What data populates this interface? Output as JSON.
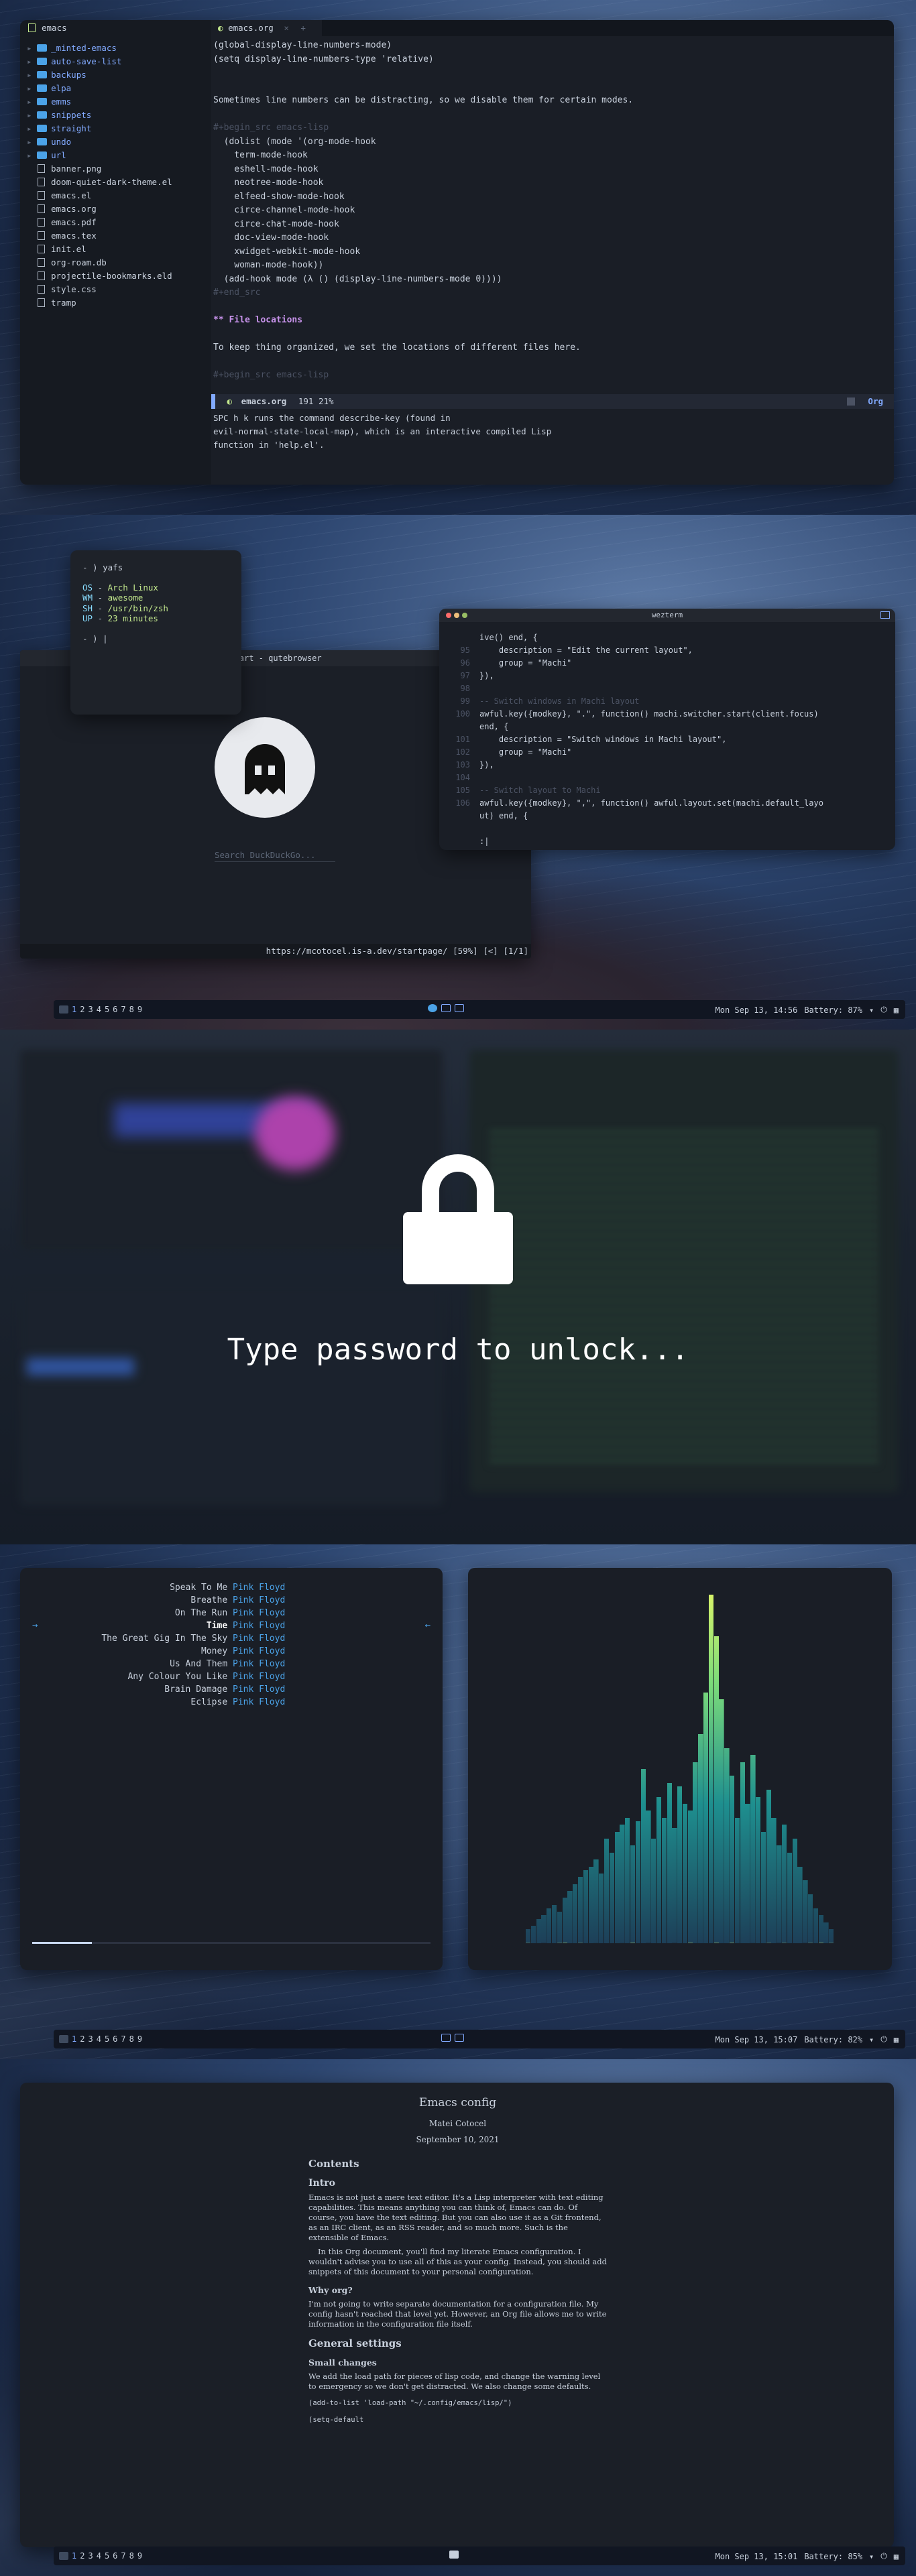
{
  "screen1": {
    "tree": {
      "title": "emacs",
      "items": [
        {
          "type": "folder",
          "name": "_minted-emacs"
        },
        {
          "type": "folder",
          "name": "auto-save-list"
        },
        {
          "type": "folder",
          "name": "backups"
        },
        {
          "type": "folder",
          "name": "elpa"
        },
        {
          "type": "folder",
          "name": "emms"
        },
        {
          "type": "folder",
          "name": "snippets"
        },
        {
          "type": "folder",
          "name": "straight"
        },
        {
          "type": "folder",
          "name": "undo"
        },
        {
          "type": "folder",
          "name": "url"
        },
        {
          "type": "file",
          "name": "banner.png"
        },
        {
          "type": "file",
          "name": "doom-quiet-dark-theme.el"
        },
        {
          "type": "file",
          "name": "emacs.el"
        },
        {
          "type": "file",
          "name": "emacs.org"
        },
        {
          "type": "file",
          "name": "emacs.pdf"
        },
        {
          "type": "file",
          "name": "emacs.tex"
        },
        {
          "type": "file",
          "name": "init.el"
        },
        {
          "type": "file",
          "name": "org-roam.db"
        },
        {
          "type": "file",
          "name": "projectile-bookmarks.eld"
        },
        {
          "type": "file",
          "name": "style.css"
        },
        {
          "type": "file",
          "name": "tramp"
        }
      ]
    },
    "tab": {
      "label": "emacs.org",
      "close": "×",
      "add": "+"
    },
    "code": [
      "(global-display-line-numbers-mode)",
      "(setq display-line-numbers-type 'relative)",
      "",
      "",
      "Sometimes line numbers can be distracting, so we disable them for certain modes.",
      "",
      "#+begin_src emacs-lisp",
      "  (dolist (mode '(org-mode-hook",
      "    term-mode-hook",
      "    eshell-mode-hook",
      "    neotree-mode-hook",
      "    elfeed-show-mode-hook",
      "    circe-channel-mode-hook",
      "    circe-chat-mode-hook",
      "    doc-view-mode-hook",
      "    xwidget-webkit-mode-hook",
      "    woman-mode-hook))",
      "  (add-hook mode (λ () (display-line-numbers-mode 0))))",
      "#+end_src",
      "",
      "** File locations",
      "",
      "To keep thing organized, we set the locations of different files here.",
      "",
      "#+begin_src emacs-lisp"
    ],
    "modeline": {
      "file": "emacs.org",
      "pos": "191 21%",
      "mode": "Org"
    },
    "echo": [
      "SPC h k runs the command describe-key (found in",
      "evil-normal-state-local-map), which is an interactive compiled Lisp",
      "function in 'help.el'."
    ]
  },
  "screen2": {
    "yafetch": {
      "prompt": "- ) yafs",
      "os_k": "OS",
      "os_v": "Arch Linux",
      "wm_k": "WM",
      "wm_v": "awesome",
      "sh_k": "SH",
      "sh_v": "/usr/bin/zsh",
      "up_k": "UP",
      "up_v": "23 minutes",
      "prompt2": "- ) |"
    },
    "browser": {
      "title": "Start - qutebrowser",
      "search_placeholder": "Search DuckDuckGo...",
      "status": "https://mcotocel.is-a.dev/startpage/ [59%] [<] [1/1]"
    },
    "wezterm": {
      "title": "wezterm",
      "lines": [
        {
          "n": "",
          "t": "ive() end, {"
        },
        {
          "n": "95",
          "t": "    description = \"Edit the current layout\","
        },
        {
          "n": "96",
          "t": "    group = \"Machi\""
        },
        {
          "n": "97",
          "t": "}),"
        },
        {
          "n": "98",
          "t": ""
        },
        {
          "n": "99",
          "t": "-- Switch windows in Machi layout"
        },
        {
          "n": "100",
          "t": "awful.key({modkey}, \".\", function() machi.switcher.start(client.focus)"
        },
        {
          "n": "",
          "t": "end, {"
        },
        {
          "n": "101",
          "t": "    description = \"Switch windows in Machi layout\","
        },
        {
          "n": "102",
          "t": "    group = \"Machi\""
        },
        {
          "n": "103",
          "t": "}),"
        },
        {
          "n": "104",
          "t": ""
        },
        {
          "n": "105",
          "t": "-- Switch layout to Machi"
        },
        {
          "n": "106",
          "t": "awful.key({modkey}, \",\", function() awful.layout.set(machi.default_layo"
        },
        {
          "n": "",
          "t": "ut) end, {"
        },
        {
          "n": "",
          "t": ""
        },
        {
          "n": "",
          "t": ":|"
        }
      ]
    },
    "bar": {
      "workspaces": [
        "1",
        "2",
        "3",
        "4",
        "5",
        "6",
        "7",
        "8",
        "9"
      ],
      "datetime": "Mon Sep 13, 14:56",
      "battery": "Battery: 87%"
    }
  },
  "screen3": {
    "message": "Type password to unlock..."
  },
  "screen4": {
    "songs": [
      {
        "title": "Speak To Me",
        "artist": "Pink Floyd"
      },
      {
        "title": "Breathe",
        "artist": "Pink Floyd"
      },
      {
        "title": "On The Run",
        "artist": "Pink Floyd"
      },
      {
        "title": "Time",
        "artist": "Pink Floyd"
      },
      {
        "title": "The Great Gig In The Sky",
        "artist": "Pink Floyd"
      },
      {
        "title": "Money",
        "artist": "Pink Floyd"
      },
      {
        "title": "Us And Them",
        "artist": "Pink Floyd"
      },
      {
        "title": "Any Colour You Like",
        "artist": "Pink Floyd"
      },
      {
        "title": "Brain Damage",
        "artist": "Pink Floyd"
      },
      {
        "title": "Eclipse",
        "artist": "Pink Floyd"
      }
    ],
    "current_index": 3,
    "progress": 0.15,
    "visualizer": [
      4,
      5,
      7,
      8,
      10,
      11,
      9,
      13,
      15,
      17,
      19,
      21,
      22,
      24,
      20,
      30,
      26,
      32,
      34,
      36,
      28,
      35,
      50,
      38,
      30,
      42,
      36,
      46,
      33,
      45,
      40,
      38,
      52,
      60,
      72,
      100,
      88,
      70,
      56,
      48,
      36,
      52,
      40,
      54,
      42,
      32,
      44,
      36,
      28,
      34,
      26,
      30,
      22,
      18,
      14,
      10,
      8,
      6,
      4
    ],
    "bar": {
      "workspaces": [
        "1",
        "2",
        "3",
        "4",
        "5",
        "6",
        "7",
        "8",
        "9"
      ],
      "datetime": "Mon Sep 13, 15:07",
      "battery": "Battery: 82%"
    }
  },
  "screen5": {
    "title": "Emacs config",
    "author": "Matei Cotocel",
    "date": "September 10, 2021",
    "contents": "Contents",
    "h_intro": "Intro",
    "p_intro1": "Emacs is not just a mere text editor. It's a Lisp interpreter with text editing capabilities. This means anything you can think of, Emacs can do. Of course, you have the text editing. But you can also use it as a Git frontend, as an IRC client, as an RSS reader, and so much more. Such is the extensible of Emacs.",
    "p_intro2": "In this Org document, you'll find my literate Emacs configuration. I wouldn't advise you to use all of this as your config. Instead, you should add snippets of this document to your personal configuration.",
    "h_why": "Why org?",
    "p_why": "I'm not going to write separate documentation for a configuration file. My config hasn't reached that level yet. However, an Org file allows me to write information in the configuration file itself.",
    "h_general": "General settings",
    "h_small": "Small changes",
    "p_small": "We add the load path for pieces of lisp code, and change the warning level to emergency so we don't get distracted. We also change some defaults.",
    "code1": "(add-to-list 'load-path \"~/.config/emacs/lisp/\")",
    "code2": "(setq-default",
    "bar": {
      "workspaces": [
        "1",
        "2",
        "3",
        "4",
        "5",
        "6",
        "7",
        "8",
        "9"
      ],
      "datetime": "Mon Sep 13, 15:01",
      "battery": "Battery: 85%"
    }
  },
  "colors": {
    "accent": "#82aaff",
    "blue": "#4ba3e8",
    "green": "#c3e88d",
    "viz_top": "#d6f36a",
    "viz_bottom": "#1d3f58"
  }
}
